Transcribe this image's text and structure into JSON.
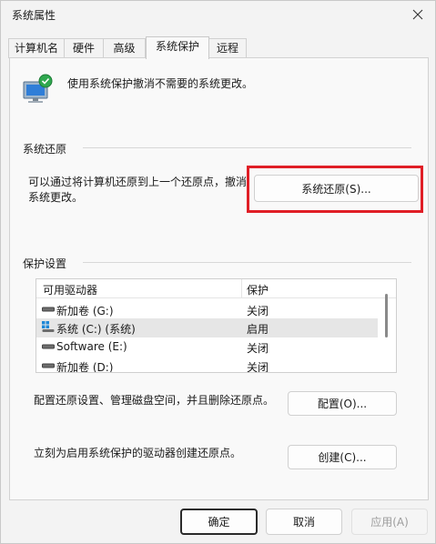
{
  "window": {
    "title": "系统属性"
  },
  "tabs": [
    {
      "label": "计算机名"
    },
    {
      "label": "硬件"
    },
    {
      "label": "高级"
    },
    {
      "label": "系统保护"
    },
    {
      "label": "远程"
    }
  ],
  "active_tab": "系统保护",
  "intro": {
    "text": "使用系统保护撤消不需要的系统更改。"
  },
  "restore": {
    "section": "系统还原",
    "desc_line1": "可以通过将计算机还原到上一个还原点，撤消",
    "desc_line2": "系统更改。",
    "button": "系统还原(S)..."
  },
  "protection": {
    "section": "保护设置",
    "col_drive": "可用驱动器",
    "col_protection": "保护",
    "drives": [
      {
        "name": "新加卷 (G:)",
        "protection": "关闭",
        "icon": "drive-icon"
      },
      {
        "name": "系统 (C:) (系统)",
        "protection": "启用",
        "icon": "windows-drive-icon"
      },
      {
        "name": "Software (E:)",
        "protection": "关闭",
        "icon": "drive-icon"
      },
      {
        "name": "新加卷 (D:)",
        "protection": "关闭",
        "icon": "drive-icon"
      }
    ],
    "selected_index": 1
  },
  "configure": {
    "text": "配置还原设置、管理磁盘空间，并且删除还原点。",
    "button": "配置(O)..."
  },
  "create": {
    "text": "立刻为启用系统保护的驱动器创建还原点。",
    "button": "创建(C)..."
  },
  "footer": {
    "ok": "确定",
    "cancel": "取消",
    "apply": "应用(A)"
  },
  "colors": {
    "highlight": "#e01e26"
  }
}
